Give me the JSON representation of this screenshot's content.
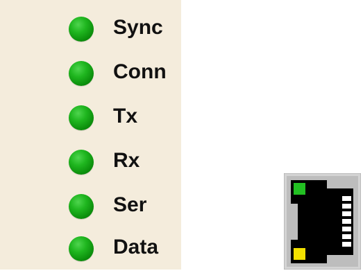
{
  "panel": {
    "background": "#f4ecdc",
    "led_color": "#14a814",
    "leds": [
      {
        "label": "Sync",
        "icon": "green-led-indicator"
      },
      {
        "label": "Conn",
        "icon": "green-led-indicator"
      },
      {
        "label": "Tx",
        "icon": "green-led-indicator"
      },
      {
        "label": "Rx",
        "icon": "green-led-indicator"
      },
      {
        "label": "Ser",
        "icon": "green-led-indicator"
      },
      {
        "label": "Data",
        "icon": "green-led-indicator"
      }
    ]
  },
  "port": {
    "icon": "ethernet-port-icon",
    "link_led_color": "#22c022",
    "activity_led_color": "#f2e000",
    "body_color": "#000000",
    "frame_color": "#c8c8c8"
  }
}
